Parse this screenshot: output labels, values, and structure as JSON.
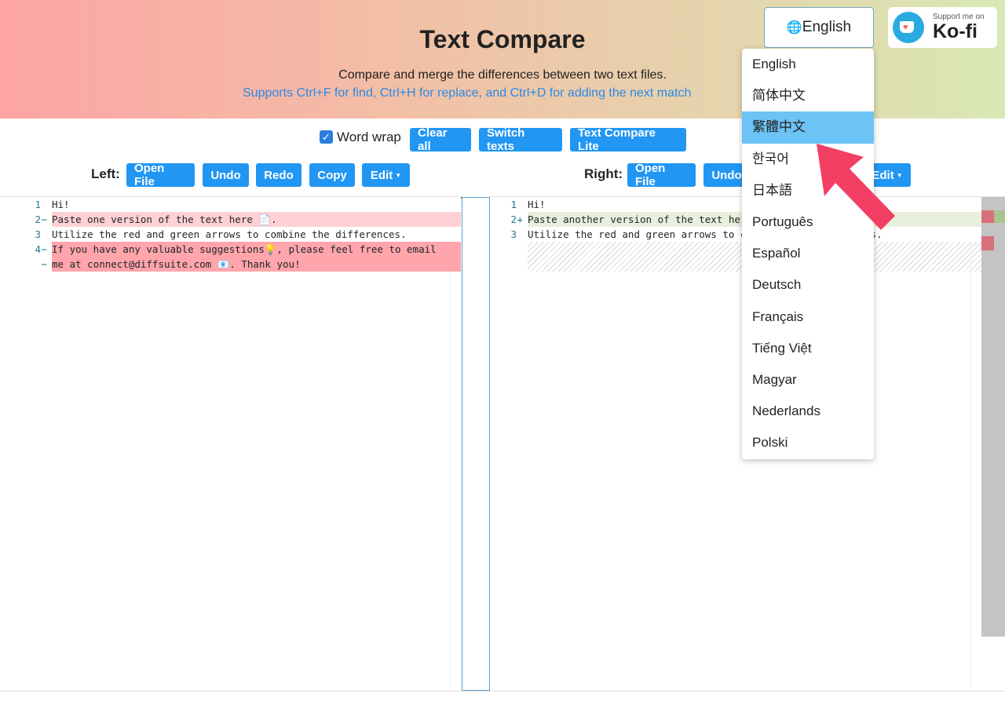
{
  "header": {
    "title": "Text Compare",
    "subtitle": "Compare and merge the differences between two text files.",
    "hint": "Supports Ctrl+F for find, Ctrl+H for replace, and Ctrl+D for adding the next match"
  },
  "language_button": {
    "label": "English",
    "icon": "globe-icon"
  },
  "kofi": {
    "small": "Support me on",
    "big": "Ko-fi"
  },
  "toolbar": {
    "word_wrap": "Word wrap",
    "word_wrap_checked": true,
    "clear_all": "Clear all",
    "switch_texts": "Switch texts",
    "lite": "Text Compare Lite"
  },
  "left": {
    "label": "Left:",
    "open": "Open File",
    "undo": "Undo",
    "redo": "Redo",
    "copy": "Copy",
    "edit": "Edit"
  },
  "right": {
    "label": "Right:",
    "open": "Open File",
    "undo": "Undo",
    "edit": "Edit"
  },
  "left_lines": [
    {
      "n": "1",
      "m": " ",
      "t": "Hi!"
    },
    {
      "n": "2",
      "m": "−",
      "t": "Paste one version of the text here 📄."
    },
    {
      "n": "3",
      "m": " ",
      "t": "Utilize the red and green arrows to combine the differences."
    },
    {
      "n": "4",
      "m": "−",
      "t": "If you have any valuable suggestions💡, please feel free to email"
    },
    {
      "n": "",
      "m": "−",
      "t": "me at connect@diffsuite.com 📧. Thank you!"
    }
  ],
  "right_lines": [
    {
      "n": "1",
      "m": " ",
      "t": "Hi!"
    },
    {
      "n": "2",
      "m": "+",
      "t": "Paste another version of the text here"
    },
    {
      "n": "3",
      "m": " ",
      "t": "Utilize the red and green arrows to combine the differences."
    }
  ],
  "languages": [
    "English",
    "简体中文",
    "繁體中文",
    "한국어",
    "日本語",
    "Português",
    "Español",
    "Deutsch",
    "Français",
    "Tiếng Việt",
    "Magyar",
    "Nederlands",
    "Polski"
  ],
  "selected_language": "繁體中文",
  "colors": {
    "accent": "#2196f3",
    "removed": "#ffa5ab",
    "removed_light": "#ffd0d4",
    "added": "#e8f0dd",
    "highlight": "#6cc3f5",
    "arrow": "#f43f64"
  }
}
